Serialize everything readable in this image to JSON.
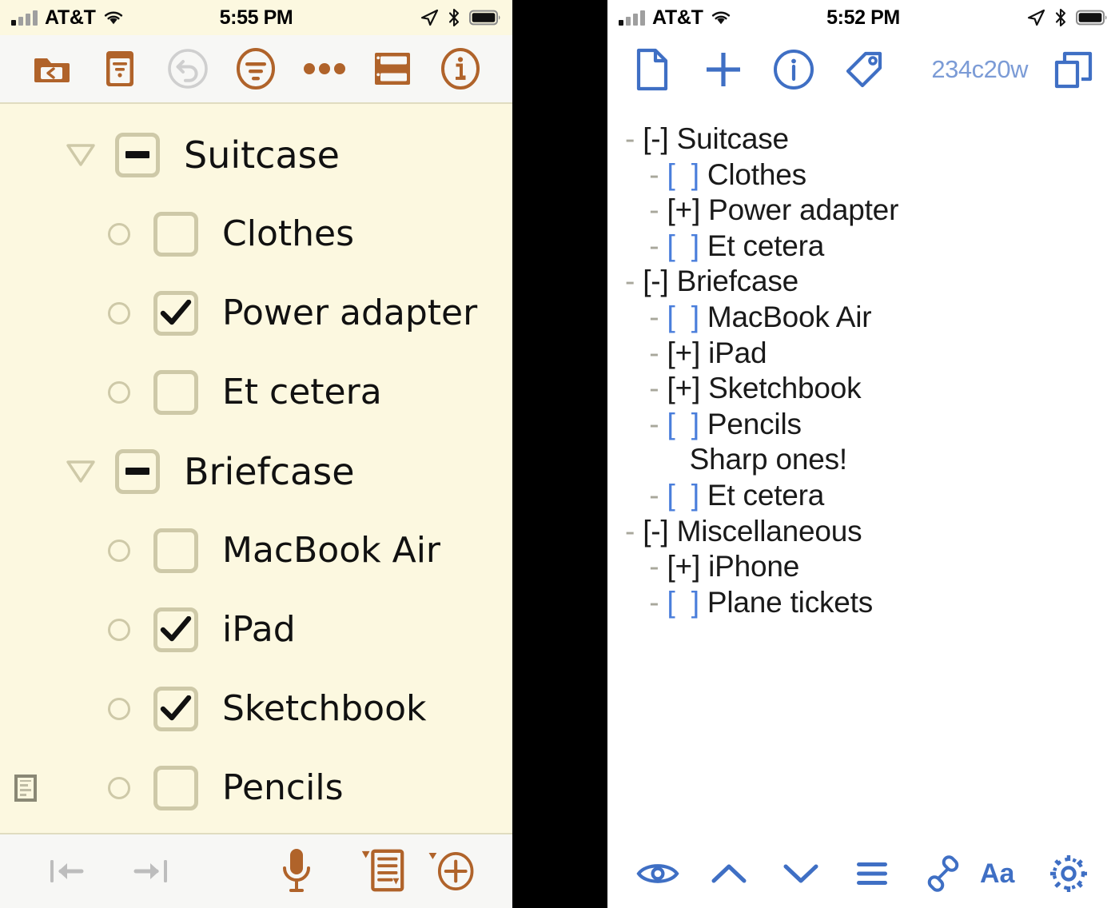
{
  "left_panel": {
    "status_bar": {
      "carrier": "AT&T",
      "time": "5:55 PM",
      "icons": [
        "signal-bars-icon",
        "wifi-icon",
        "location-arrow-icon",
        "bluetooth-icon",
        "battery-icon"
      ]
    },
    "toolbar": {
      "buttons": [
        {
          "name": "folder-back-icon",
          "label": "Back to documents"
        },
        {
          "name": "document-outline-icon",
          "label": "Outline"
        },
        {
          "name": "undo-icon",
          "label": "Undo"
        },
        {
          "name": "filter-icon",
          "label": "Filter"
        },
        {
          "name": "more-icon",
          "label": "More"
        },
        {
          "name": "split-view-icon",
          "label": "Split view"
        },
        {
          "name": "info-icon",
          "label": "Info"
        }
      ]
    },
    "rows": [
      {
        "level": 0,
        "type": "parent",
        "state": "minus",
        "label": "Suitcase"
      },
      {
        "level": 1,
        "type": "child",
        "state": "unchecked",
        "label": "Clothes"
      },
      {
        "level": 1,
        "type": "child",
        "state": "checked",
        "label": "Power adapter"
      },
      {
        "level": 1,
        "type": "child",
        "state": "unchecked",
        "label": "Et cetera"
      },
      {
        "level": 0,
        "type": "parent",
        "state": "minus",
        "label": "Briefcase"
      },
      {
        "level": 1,
        "type": "child",
        "state": "unchecked",
        "label": "MacBook Air"
      },
      {
        "level": 1,
        "type": "child",
        "state": "checked",
        "label": "iPad"
      },
      {
        "level": 1,
        "type": "child",
        "state": "checked",
        "label": "Sketchbook"
      },
      {
        "level": 1,
        "type": "child",
        "state": "unchecked",
        "label": "Pencils",
        "has_note": true
      }
    ],
    "bottom_bar": {
      "buttons": [
        {
          "name": "outdent-icon",
          "label": "Outdent"
        },
        {
          "name": "indent-icon",
          "label": "Indent"
        },
        {
          "name": "microphone-icon",
          "label": "Dictate"
        },
        {
          "name": "add-note-icon",
          "label": "Add note"
        },
        {
          "name": "add-row-icon",
          "label": "Add row"
        }
      ]
    }
  },
  "right_panel": {
    "status_bar": {
      "carrier": "AT&T",
      "time": "5:52 PM",
      "icons": [
        "signal-bars-icon",
        "wifi-icon",
        "location-arrow-icon",
        "bluetooth-icon",
        "battery-icon"
      ]
    },
    "toolbar": {
      "buttons": [
        {
          "name": "new-document-icon",
          "label": "New document"
        },
        {
          "name": "plus-icon",
          "label": "Add"
        },
        {
          "name": "info-icon",
          "label": "Info"
        },
        {
          "name": "tag-icon",
          "label": "Tags"
        },
        {
          "name": "duplicate-icon",
          "label": "Duplicate"
        }
      ],
      "doc_code": "234c20w"
    },
    "lines": [
      {
        "indent": 0,
        "dash": "-",
        "mark": "[-]",
        "mark_state": "checked",
        "text": "Suitcase"
      },
      {
        "indent": 1,
        "dash": "-",
        "mark": "[  ]",
        "mark_state": "unchecked",
        "text": "Clothes"
      },
      {
        "indent": 1,
        "dash": "-",
        "mark": "[+]",
        "mark_state": "checked",
        "text": "Power adapter"
      },
      {
        "indent": 1,
        "dash": "-",
        "mark": "[  ]",
        "mark_state": "unchecked",
        "text": "Et cetera"
      },
      {
        "indent": 0,
        "dash": "-",
        "mark": "[-]",
        "mark_state": "checked",
        "text": "Briefcase"
      },
      {
        "indent": 1,
        "dash": "-",
        "mark": "[  ]",
        "mark_state": "unchecked",
        "text": "MacBook Air"
      },
      {
        "indent": 1,
        "dash": "-",
        "mark": "[+]",
        "mark_state": "checked",
        "text": "iPad"
      },
      {
        "indent": 1,
        "dash": "-",
        "mark": "[+]",
        "mark_state": "checked",
        "text": "Sketchbook"
      },
      {
        "indent": 1,
        "dash": "-",
        "mark": "[  ]",
        "mark_state": "unchecked",
        "text": "Pencils"
      },
      {
        "indent": 1,
        "dash": "",
        "mark": "",
        "mark_state": "none",
        "text": "Sharp ones!"
      },
      {
        "indent": 1,
        "dash": "-",
        "mark": "[  ]",
        "mark_state": "unchecked",
        "text": "Et cetera"
      },
      {
        "indent": 0,
        "dash": "-",
        "mark": "[-]",
        "mark_state": "checked",
        "text": "Miscellaneous"
      },
      {
        "indent": 1,
        "dash": "-",
        "mark": "[+]",
        "mark_state": "checked",
        "text": "iPhone"
      },
      {
        "indent": 1,
        "dash": "-",
        "mark": "[  ]",
        "mark_state": "unchecked",
        "text": "Plane tickets"
      }
    ],
    "bottom_bar": {
      "buttons": [
        {
          "name": "eye-icon",
          "label": "Preview"
        },
        {
          "name": "chevron-up-icon",
          "label": "Previous"
        },
        {
          "name": "chevron-down-icon",
          "label": "Next"
        },
        {
          "name": "list-icon",
          "label": "List"
        },
        {
          "name": "link-icon",
          "label": "Link"
        },
        {
          "name": "text-size-icon",
          "label": "Aa"
        },
        {
          "name": "gear-icon",
          "label": "Settings"
        }
      ]
    }
  },
  "colors": {
    "left_background": "#FCF8E0",
    "left_chrome": "#F7F7F5",
    "left_accent": "#B0632A",
    "left_muted": "#CEC9A8",
    "right_accent": "#3F6FC4",
    "right_muted": "#7B9BD6",
    "gap": "#000000"
  }
}
